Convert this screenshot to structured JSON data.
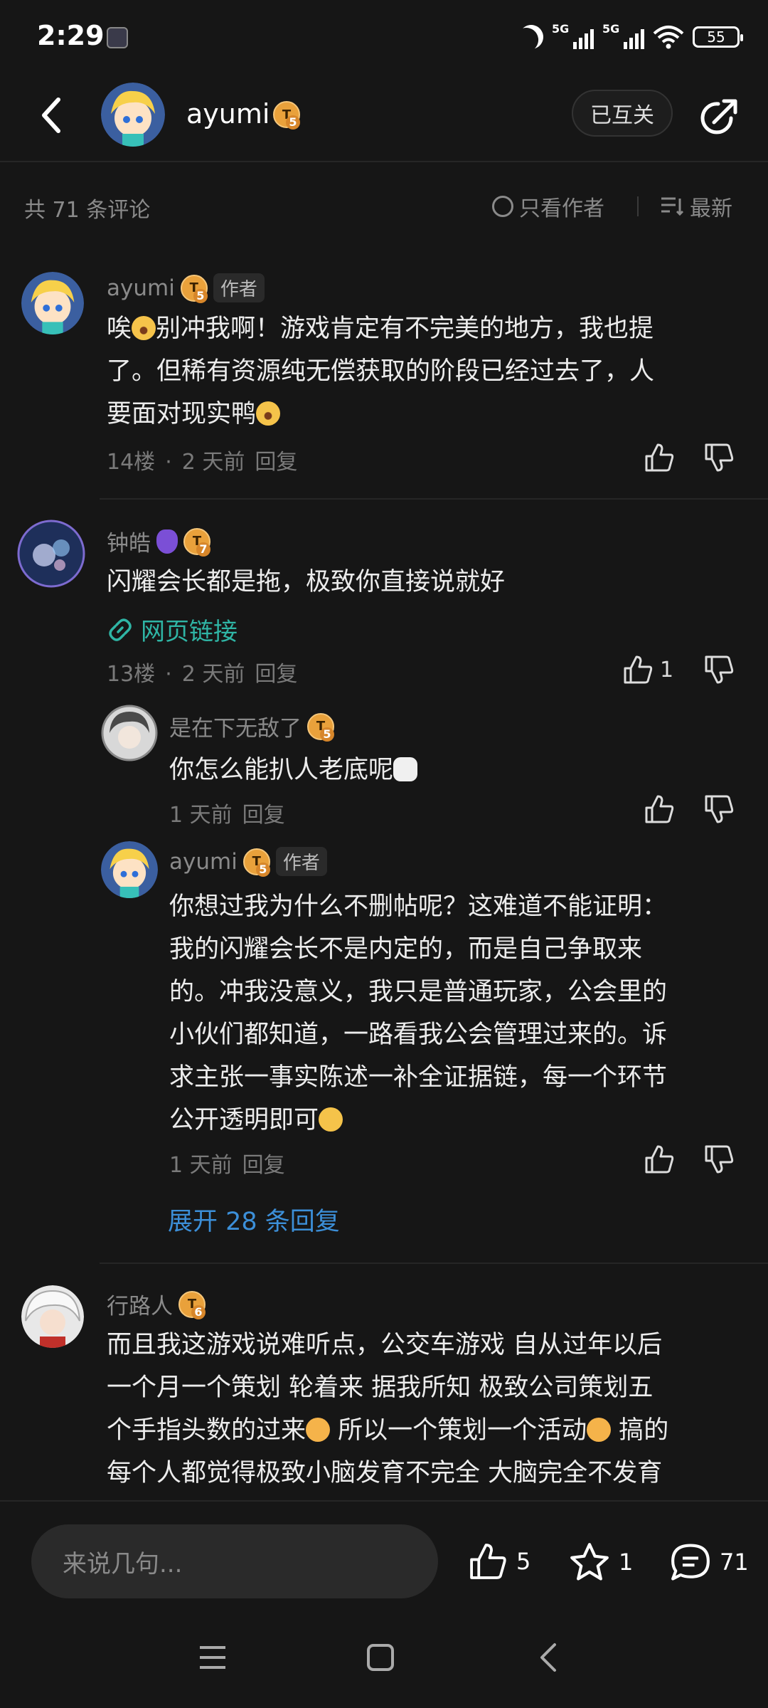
{
  "status": {
    "time": "2:29",
    "net1": "5G",
    "net2": "5G",
    "battery": "55"
  },
  "header": {
    "username": "ayumi",
    "level": "5",
    "mutual": "已互关"
  },
  "filter": {
    "count": "共 71 条评论",
    "author_only": "只看作者",
    "sort": "最新"
  },
  "comments": [
    {
      "name": "ayumi",
      "level": "5",
      "author_tag": "作者",
      "lines": [
        "唉",
        "别冲我啊！游戏肯定有不完美的地方，我也提",
        "了。但稀有资源纯无偿获取的阶段已经过去了，人",
        "要面对现实鸭"
      ],
      "floor": "14楼",
      "time": "2 天前",
      "reply": "回复"
    },
    {
      "name": "钟皓",
      "level": "7",
      "lines": [
        "闪耀会长都是拖，极致你直接说就好"
      ],
      "link": "网页链接",
      "floor": "13楼",
      "time": "2 天前",
      "reply": "回复",
      "likes": "1",
      "replies": [
        {
          "name": "是在下无敌了",
          "level": "5",
          "lines": [
            "你怎么能扒人老底呢"
          ],
          "time": "1 天前",
          "reply": "回复"
        },
        {
          "name": "ayumi",
          "level": "5",
          "author_tag": "作者",
          "lines": [
            "你想过我为什么不删帖呢？这难道不能证明：",
            "我的闪耀会长不是内定的，而是自己争取来",
            "的。冲我没意义，我只是普通玩家，公会里的",
            "小伙们都知道，一路看我公会管理过来的。诉",
            "求主张一事实陈述一补全证据链，每一个环节",
            "公开透明即可"
          ],
          "time": "1 天前",
          "reply": "回复"
        }
      ],
      "expand": "展开 28 条回复"
    },
    {
      "name": "行路人",
      "level": "6",
      "lines": [
        "而且我这游戏说难听点，公交车游戏 自从过年以后",
        "一个月一个策划 轮着来 据我所知 极致公司策划五",
        "个手指头数的过来",
        " 所以一个策划一个活动",
        " 搞的",
        "每个人都觉得极致小脑发育不完全 大脑完全不发育"
      ]
    }
  ],
  "bottom": {
    "placeholder": "来说几句...",
    "likes": "5",
    "stars": "1",
    "comments": "71"
  }
}
